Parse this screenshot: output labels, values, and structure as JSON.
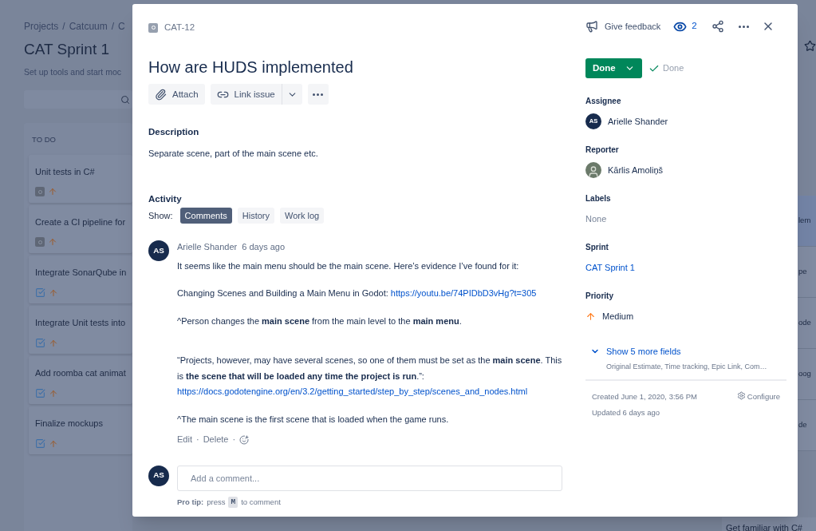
{
  "board": {
    "breadcrumbs": [
      "Projects",
      "Catcuum",
      "C"
    ],
    "breadcrumb_separator": "/",
    "title": "CAT Sprint 1",
    "subtitle": "Set up tools and start moc",
    "column": {
      "title": "TO DO",
      "cards": [
        {
          "title": "Unit tests in C#",
          "kind": "other"
        },
        {
          "title": "Create a CI pipeline for",
          "kind": "other"
        },
        {
          "title": "Integrate SonarQube in",
          "kind": "task"
        },
        {
          "title": "Integrate Unit tests into",
          "kind": "task"
        },
        {
          "title": "Add roomba cat animat",
          "kind": "task"
        },
        {
          "title": "Finalize mockups",
          "kind": "task"
        }
      ]
    },
    "side_cards": [
      {
        "text": "lem",
        "selected": true
      },
      {
        "text": "pe",
        "selected": false
      },
      {
        "text": "ode",
        "selected": false
      },
      {
        "text": "oog",
        "selected": false
      },
      {
        "text": "de",
        "selected": false
      }
    ],
    "bottom_card": "Get familiar with C#"
  },
  "issue": {
    "key": "CAT-12",
    "title": "How are HUDS implemented",
    "actions": [
      {
        "label": "Attach",
        "kind": "attach"
      },
      {
        "label": "Link issue",
        "kind": "link"
      }
    ],
    "description": {
      "heading": "Description",
      "text": "Separate scene, part of the main scene etc."
    },
    "activity": {
      "heading": "Activity",
      "show_label": "Show:",
      "filters": [
        {
          "label": "Comments",
          "selected": true
        },
        {
          "label": "History",
          "selected": false
        },
        {
          "label": "Work log",
          "selected": false
        }
      ]
    },
    "comments": [
      {
        "initials": "AS",
        "author": "Arielle Shander",
        "time": "6 days ago",
        "paragraphs": [
          [
            {
              "kind": "text",
              "text": "It seems like the main menu should be the main scene. Here’s evidence I’ve found for it:"
            }
          ],
          [
            {
              "kind": "text",
              "text": "Changing Scenes and Building a Main Menu in Godot: "
            },
            {
              "kind": "link",
              "text": "https://youtu.be/74PIDbD3vHg?t=305"
            }
          ],
          [
            {
              "kind": "text",
              "text": "^Person changes the **main scene** from the main level to the **main menu**."
            }
          ],
          [
            {
              "kind": "text",
              "text": "“Projects, however, may have several scenes, so one of them must be set as the **main scene**. This is **the scene that will be loaded any time the project is run**.”: "
            },
            {
              "kind": "link",
              "text": "https://docs.godotengine.org/en/3.2"
            },
            {
              "kind": "link",
              "text": "/getting_started/step_by_step/scenes_and_nodes.html"
            }
          ],
          [
            {
              "kind": "text",
              "text": "^The main scene is the first scene that is loaded when the game runs."
            }
          ]
        ],
        "actions": [
          "Edit",
          "Delete"
        ],
        "action_separator": "·"
      }
    ],
    "new_comment": {
      "initials": "AS",
      "placeholder": "Add a comment...",
      "tip_label": "Pro tip:",
      "tip_before": "press",
      "tip_key": "M",
      "tip_after": "to comment"
    },
    "feedback": "Give feedback",
    "watchers": "2",
    "status": "Done",
    "resolution": "Done",
    "fields": [
      {
        "label": "Assignee",
        "kind": "user",
        "value": "Arielle Shander",
        "initials": "AS"
      },
      {
        "label": "Reporter",
        "kind": "photo-user",
        "value": "Kārlis Amoliņš"
      },
      {
        "label": "Labels",
        "kind": "empty",
        "value": "None"
      },
      {
        "label": "Sprint",
        "kind": "link",
        "value": "CAT Sprint 1"
      },
      {
        "label": "Priority",
        "kind": "priority",
        "value": "Medium"
      }
    ],
    "more_fields": {
      "label": "Show 5 more fields",
      "detail": "Original Estimate, Time tracking, Epic Link, Com…"
    },
    "created": "Created June 1, 2020, 3:56 PM",
    "updated": "Updated 6 days ago",
    "configure": "Configure"
  }
}
